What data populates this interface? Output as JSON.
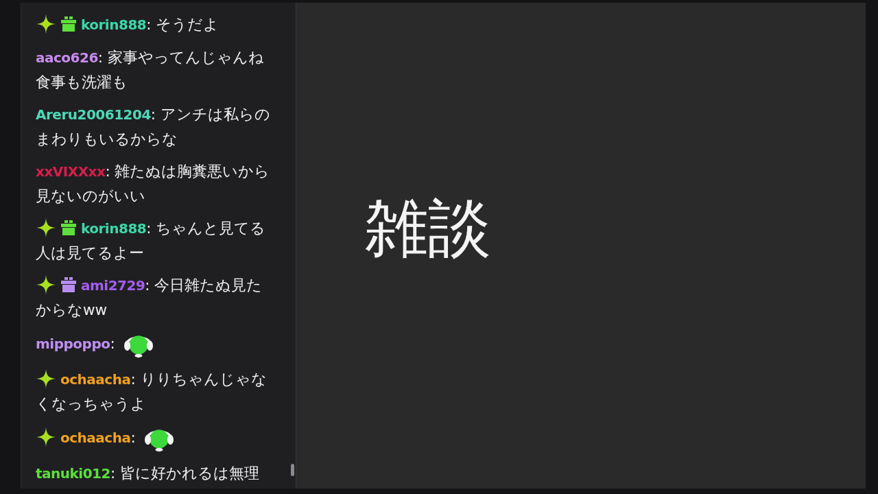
{
  "chat": {
    "messages": [
      {
        "badges": [
          {
            "kind": "sparkle"
          },
          {
            "kind": "gift",
            "color": "#5fe03a"
          }
        ],
        "user": "korin888",
        "color": "#3ad8a8",
        "separator": ":",
        "kind": "text",
        "text": "そうだよ"
      },
      {
        "user": "aaco626",
        "color": "#c88cf0",
        "separator": ":",
        "kind": "text",
        "text": "家事やってんじゃんね食事も洗濯も"
      },
      {
        "user": "Areru20061204",
        "color": "#4fd8b8",
        "separator": ":",
        "kind": "text",
        "text": "アンチは私らのまわりもいるからな"
      },
      {
        "user": "xxVIXXxx",
        "color": "#d81e4a",
        "separator": ":",
        "kind": "text",
        "text": "雑たぬは胸糞悪いから見ないのがいい"
      },
      {
        "badges": [
          {
            "kind": "sparkle"
          },
          {
            "kind": "gift",
            "color": "#5fe03a"
          }
        ],
        "user": "korin888",
        "color": "#3ad8a8",
        "separator": ":",
        "kind": "text",
        "text": "ちゃんと見てる人は見てるよー"
      },
      {
        "badges": [
          {
            "kind": "sparkle"
          },
          {
            "kind": "gift",
            "color": "#b98cf0"
          }
        ],
        "user": "ami2729",
        "color": "#a55ef0",
        "separator": ":",
        "kind": "text",
        "text": "今日雑たぬ見たからなww"
      },
      {
        "user": "mippoppo",
        "color": "#c08ef0",
        "separator": ":",
        "kind": "emote"
      },
      {
        "badges": [
          {
            "kind": "sparkle"
          }
        ],
        "user": "ochaacha",
        "color": "#f0a020",
        "separator": ":",
        "kind": "text",
        "text": "りりちゃんじゃなくなっちゃうよ"
      },
      {
        "badges": [
          {
            "kind": "sparkle"
          }
        ],
        "user": "ochaacha",
        "color": "#f0a020",
        "separator": ":",
        "kind": "emote"
      },
      {
        "user": "tanuki012",
        "color": "#5ae03a",
        "separator": ":",
        "kind": "text",
        "text": "皆に好かれるは無理"
      }
    ]
  },
  "stage": {
    "title": "雑談"
  }
}
